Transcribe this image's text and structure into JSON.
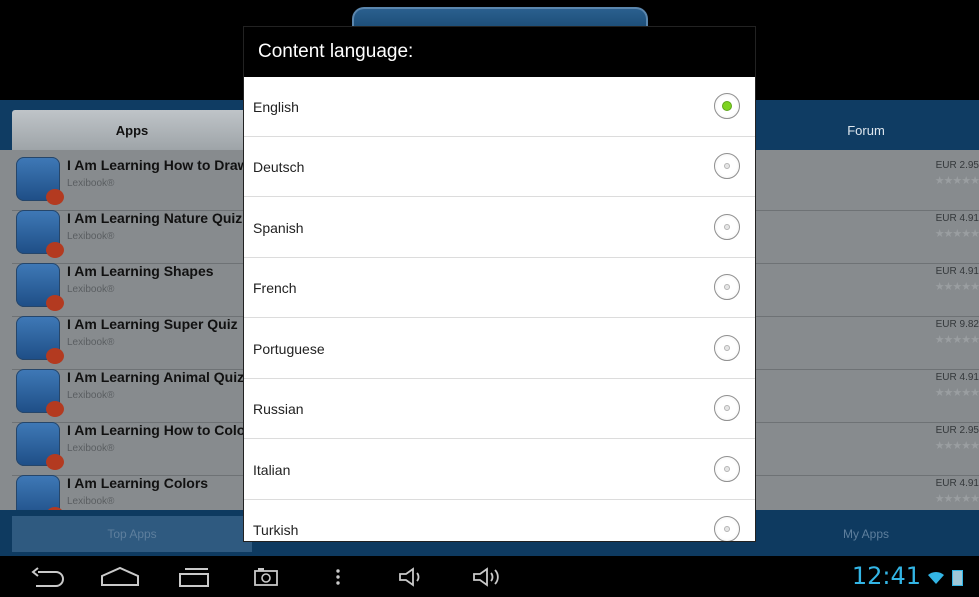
{
  "tabs": {
    "apps": "Apps",
    "forum": "Forum"
  },
  "apps": [
    {
      "title": "I Am Learning How to Draw",
      "developer": "Lexibook®",
      "price": "EUR 2.95",
      "stars": "★★★★★"
    },
    {
      "title": "I Am Learning Nature Quiz",
      "developer": "Lexibook®",
      "price": "EUR 4.91",
      "stars": "★★★★★"
    },
    {
      "title": "I Am Learning Shapes",
      "developer": "Lexibook®",
      "price": "EUR 4.91",
      "stars": "★★★★★"
    },
    {
      "title": "I Am Learning Super Quiz",
      "developer": "Lexibook®",
      "price": "EUR 9.82",
      "stars": "★★★★★"
    },
    {
      "title": "I Am Learning Animal Quiz",
      "developer": "Lexibook®",
      "price": "EUR 4.91",
      "stars": "★★★★★"
    },
    {
      "title": "I Am Learning How to Colo",
      "developer": "Lexibook®",
      "price": "EUR 2.95",
      "stars": "★★★★★"
    },
    {
      "title": "I Am Learning Colors",
      "developer": "Lexibook®",
      "price": "EUR 4.91",
      "stars": "★★★★★"
    }
  ],
  "bottom_nav": {
    "top_apps": "Top Apps",
    "my_apps": "My Apps"
  },
  "dialog": {
    "title": "Content language:",
    "selected": "English",
    "languages": [
      "English",
      "Deutsch",
      "Spanish",
      "French",
      "Portuguese",
      "Russian",
      "Italian",
      "Turkish"
    ]
  },
  "status_bar": {
    "time": "12:41"
  },
  "icons": {
    "back": "back-icon",
    "home": "home-icon",
    "recents": "recent-apps-icon",
    "screenshot": "screenshot-icon",
    "menu": "overflow-menu-icon",
    "volume_down": "volume-down-icon",
    "volume_up": "volume-up-icon",
    "wifi": "wifi-icon",
    "battery": "battery-icon"
  },
  "colors": {
    "accent": "#33b5e5",
    "radio_selected": "#7ed321",
    "header_bg": "#0f3c63"
  }
}
